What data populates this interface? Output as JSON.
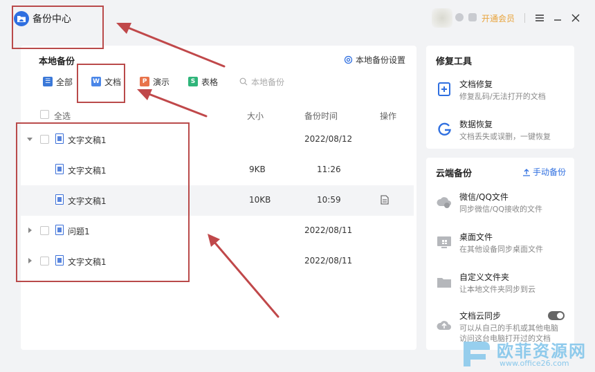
{
  "window": {
    "title": "备份中心",
    "vip_label": "开通会员"
  },
  "local_backup": {
    "title": "本地备份",
    "settings_label": "本地备份设置",
    "filters": [
      {
        "label": "全部",
        "icon_letter": "☰",
        "color": "#3a78d8"
      },
      {
        "label": "文档",
        "icon_letter": "W",
        "color": "#4a86e8"
      },
      {
        "label": "演示",
        "icon_letter": "P",
        "color": "#e8734a"
      },
      {
        "label": "表格",
        "icon_letter": "S",
        "color": "#2fb57a"
      }
    ],
    "search_placeholder": "本地备份",
    "columns": {
      "select_all": "全选",
      "size": "大小",
      "time": "备份时间",
      "action": "操作"
    },
    "rows": [
      {
        "name": "文字文稿1",
        "size": "",
        "time": "2022/08/12",
        "expanded": true,
        "level": 0
      },
      {
        "name": "文字文稿1",
        "size": "9KB",
        "time": "11:26",
        "level": 1
      },
      {
        "name": "文字文稿1",
        "size": "10KB",
        "time": "10:59",
        "level": 1,
        "highlighted": true
      },
      {
        "name": "问题1",
        "size": "",
        "time": "2022/08/11",
        "expanded": false,
        "level": 0
      },
      {
        "name": "文字文稿1",
        "size": "",
        "time": "2022/08/11",
        "expanded": false,
        "level": 0
      }
    ]
  },
  "repair_tools": {
    "title": "修复工具",
    "items": [
      {
        "name": "文档修复",
        "desc": "修复乱码/无法打开的文档"
      },
      {
        "name": "数据恢复",
        "desc": "文档丢失或误删，一键恢复"
      }
    ]
  },
  "cloud_backup": {
    "title": "云端备份",
    "manual_label": "手动备份",
    "items": [
      {
        "name": "微信/QQ文件",
        "desc": "同步微信/QQ接收的文件"
      },
      {
        "name": "桌面文件",
        "desc": "在其他设备同步桌面文件"
      },
      {
        "name": "自定义文件夹",
        "desc": "让本地文件夹同步到云"
      },
      {
        "name": "文档云同步",
        "desc": "可以从自己的手机或其他电脑",
        "desc2": "访问这台电脑打开过的文档"
      }
    ]
  },
  "watermark": {
    "text": "欧菲资源网",
    "url": "www.office26.com"
  }
}
